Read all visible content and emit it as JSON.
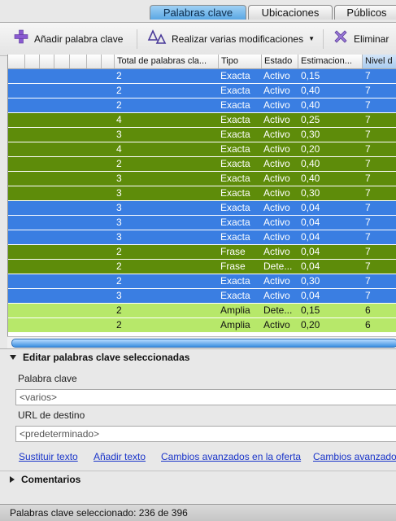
{
  "tabs": [
    {
      "label": "Palabras clave",
      "active": true
    },
    {
      "label": "Ubicaciones",
      "active": false
    },
    {
      "label": "Públicos",
      "active": false
    }
  ],
  "toolbar": {
    "add_label": "Añadir palabra clave",
    "multi_label": "Realizar varias modificaciones",
    "delete_label": "Eliminar"
  },
  "table": {
    "columns": [
      "Total de palabras cla...",
      "Tipo",
      "Estado",
      "Estimacion...",
      "Nivel d"
    ],
    "rows": [
      {
        "total": "2",
        "tipo": "Exacta",
        "estado": "Activo",
        "estimacion": "0,15",
        "nivel": "7",
        "bg": "#3a7ee2"
      },
      {
        "total": "2",
        "tipo": "Exacta",
        "estado": "Activo",
        "estimacion": "0,40",
        "nivel": "7",
        "bg": "#3a7ee2"
      },
      {
        "total": "2",
        "tipo": "Exacta",
        "estado": "Activo",
        "estimacion": "0,40",
        "nivel": "7",
        "bg": "#3a7ee2"
      },
      {
        "total": "4",
        "tipo": "Exacta",
        "estado": "Activo",
        "estimacion": "0,25",
        "nivel": "7",
        "bg": "#5e8c0a"
      },
      {
        "total": "3",
        "tipo": "Exacta",
        "estado": "Activo",
        "estimacion": "0,30",
        "nivel": "7",
        "bg": "#5e8c0a"
      },
      {
        "total": "4",
        "tipo": "Exacta",
        "estado": "Activo",
        "estimacion": "0,20",
        "nivel": "7",
        "bg": "#5e8c0a"
      },
      {
        "total": "2",
        "tipo": "Exacta",
        "estado": "Activo",
        "estimacion": "0,40",
        "nivel": "7",
        "bg": "#5e8c0a"
      },
      {
        "total": "3",
        "tipo": "Exacta",
        "estado": "Activo",
        "estimacion": "0,40",
        "nivel": "7",
        "bg": "#5e8c0a"
      },
      {
        "total": "3",
        "tipo": "Exacta",
        "estado": "Activo",
        "estimacion": "0,30",
        "nivel": "7",
        "bg": "#5e8c0a"
      },
      {
        "total": "3",
        "tipo": "Exacta",
        "estado": "Activo",
        "estimacion": "0,04",
        "nivel": "7",
        "bg": "#3a7ee2"
      },
      {
        "total": "3",
        "tipo": "Exacta",
        "estado": "Activo",
        "estimacion": "0,04",
        "nivel": "7",
        "bg": "#3a7ee2"
      },
      {
        "total": "3",
        "tipo": "Exacta",
        "estado": "Activo",
        "estimacion": "0,04",
        "nivel": "7",
        "bg": "#3a7ee2"
      },
      {
        "total": "2",
        "tipo": "Frase",
        "estado": "Activo",
        "estimacion": "0,04",
        "nivel": "7",
        "bg": "#5e8c0a"
      },
      {
        "total": "2",
        "tipo": "Frase",
        "estado": "Dete...",
        "estimacion": "0,04",
        "nivel": "7",
        "bg": "#5e8c0a"
      },
      {
        "total": "2",
        "tipo": "Exacta",
        "estado": "Activo",
        "estimacion": "0,30",
        "nivel": "7",
        "bg": "#3a7ee2"
      },
      {
        "total": "3",
        "tipo": "Exacta",
        "estado": "Activo",
        "estimacion": "0,04",
        "nivel": "7",
        "bg": "#3a7ee2"
      },
      {
        "total": "2",
        "tipo": "Amplia",
        "estado": "Dete...",
        "estimacion": "0,15",
        "nivel": "6",
        "bg": "#b7e86a"
      },
      {
        "total": "2",
        "tipo": "Amplia",
        "estado": "Activo",
        "estimacion": "0,20",
        "nivel": "6",
        "bg": "#b7e86a"
      }
    ]
  },
  "editpanel": {
    "title": "Editar palabras clave seleccionadas",
    "keyword_label": "Palabra clave",
    "keyword_value": "<varios>",
    "url_label": "URL de destino",
    "url_value": "<predeterminado>",
    "links": [
      "Sustituir texto",
      "Añadir texto",
      "Cambios avanzados en la oferta",
      "Cambios avanzados"
    ]
  },
  "comments_title": "Comentarios",
  "status_text": "Palabras clave seleccionado: 236 de 396",
  "colors": {
    "selected_blue": "#3a7ee2",
    "green_dark": "#5e8c0a",
    "green_light": "#b7e86a",
    "link": "#1a35c9"
  }
}
